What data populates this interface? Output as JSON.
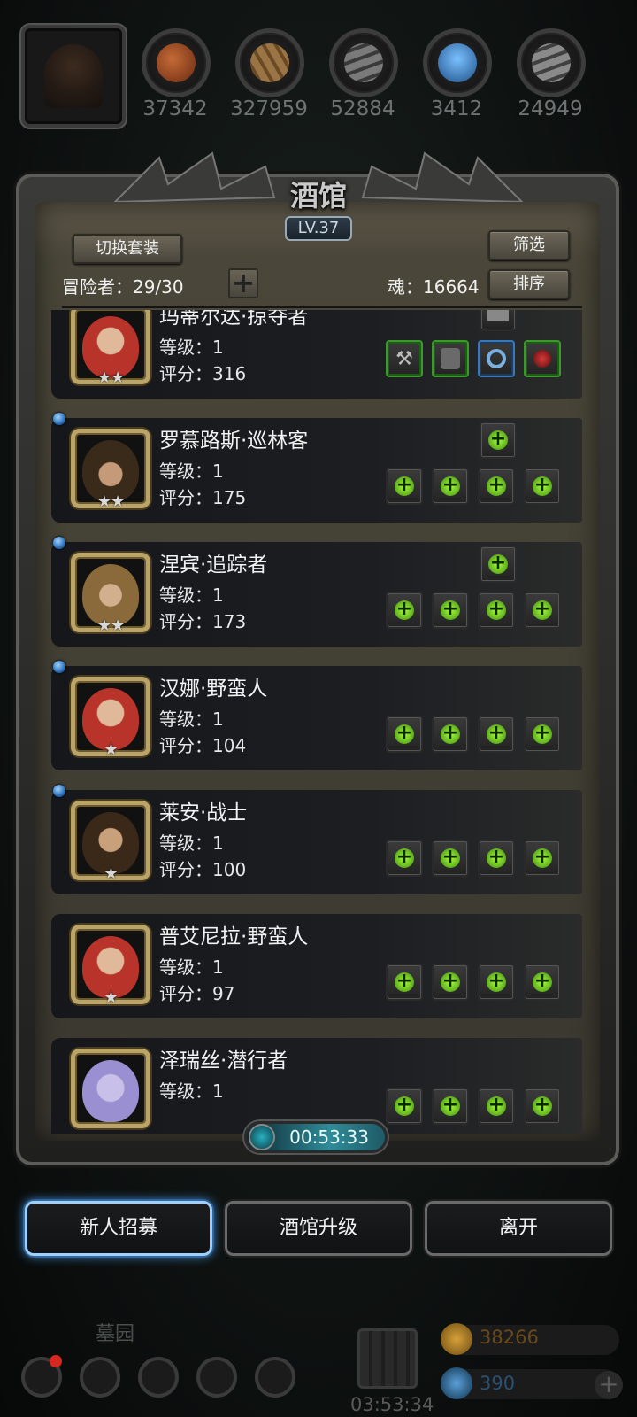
{
  "resources": [
    {
      "icon": "meat-icon",
      "value": "37342",
      "color": "#b35a2a"
    },
    {
      "icon": "wood-icon",
      "value": "327959",
      "color": "#8a6a3a"
    },
    {
      "icon": "iron-icon",
      "value": "52884",
      "color": "#6b6b6b"
    },
    {
      "icon": "crystal-icon",
      "value": "3412",
      "color": "#3a7ab8"
    },
    {
      "icon": "steel-icon",
      "value": "24949",
      "color": "#7a7a7a"
    }
  ],
  "panel": {
    "title": "酒馆",
    "level": "LV.37",
    "switch_set_label": "切换套装",
    "filter_label": "筛选",
    "sort_label": "排序",
    "adventurers_label": "冒险者：29/30",
    "soul_label": "魂：16664"
  },
  "heroes": [
    {
      "name": "玛蒂尔达·掠夺者",
      "level": "等级：1",
      "score": "评分：316",
      "stars": "★★",
      "face_color": "#b8332a",
      "gem": false,
      "equipped": true
    },
    {
      "name": "罗慕路斯·巡林客",
      "level": "等级：1",
      "score": "评分：175",
      "stars": "★★",
      "face_color": "#5a3a22",
      "gem": true,
      "equipped": false
    },
    {
      "name": "涅宾·追踪者",
      "level": "等级：1",
      "score": "评分：173",
      "stars": "★★",
      "face_color": "#8a6a3a",
      "gem": true,
      "equipped": false
    },
    {
      "name": "汉娜·野蛮人",
      "level": "等级：1",
      "score": "评分：104",
      "stars": "★",
      "face_color": "#b8332a",
      "gem": true,
      "equipped": false
    },
    {
      "name": "莱安·战士",
      "level": "等级：1",
      "score": "评分：100",
      "stars": "★",
      "face_color": "#4a3424",
      "gem": true,
      "equipped": false
    },
    {
      "name": "普艾尼拉·野蛮人",
      "level": "等级：1",
      "score": "评分：97",
      "stars": "★",
      "face_color": "#b8332a",
      "gem": false,
      "equipped": false
    },
    {
      "name": "泽瑞丝·潜行者",
      "level": "等级：1",
      "score": "",
      "stars": "",
      "face_color": "#9a8fd0",
      "gem": false,
      "equipped": false
    }
  ],
  "timer": "00:53:33",
  "actions": {
    "recruit": "新人招募",
    "upgrade": "酒馆升级",
    "leave": "离开"
  },
  "bottom": {
    "graveyard": "墓园",
    "chest_timer": "03:53:34",
    "gold": "38266",
    "gems": "390"
  }
}
